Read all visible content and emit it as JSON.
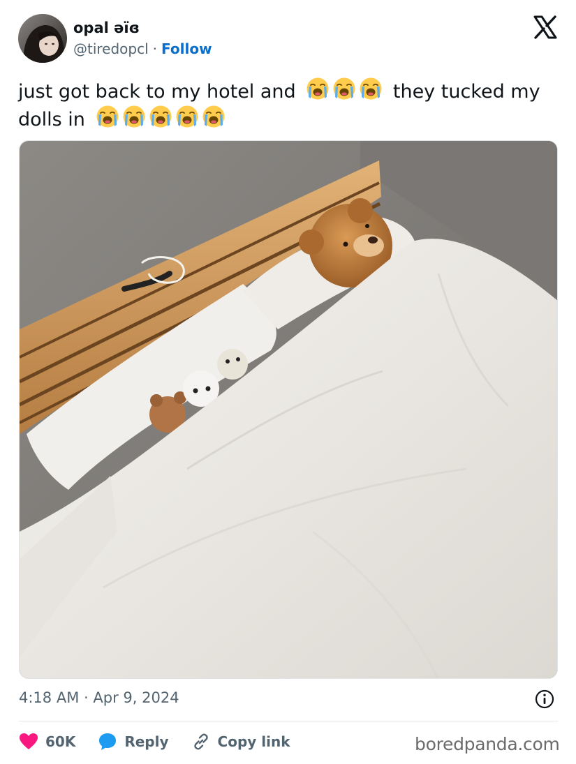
{
  "author": {
    "name": "opal əïɞ",
    "handle": "@tiredopcl",
    "separator": "·",
    "follow_label": "Follow"
  },
  "tweet": {
    "text_before": "just got back to my hotel and",
    "text_after": "they tucked my dolls in",
    "emoji_icon": "loudly-crying-face",
    "emoji_first_group_count": 3,
    "emoji_second_group_count": 5
  },
  "photo": {
    "subject": "teddy bear and small dolls tucked into a hotel bed"
  },
  "meta": {
    "time": "4:18 AM",
    "separator": "·",
    "date": "Apr 9, 2024"
  },
  "actions": {
    "likes": "60K",
    "reply_label": "Reply",
    "copy_link_label": "Copy link"
  },
  "watermark": "boredpanda.com",
  "colors": {
    "link_blue": "#0a6fcb",
    "heart_pink": "#f91880",
    "reply_blue": "#1d9bf0",
    "muted_gray": "#536471"
  }
}
